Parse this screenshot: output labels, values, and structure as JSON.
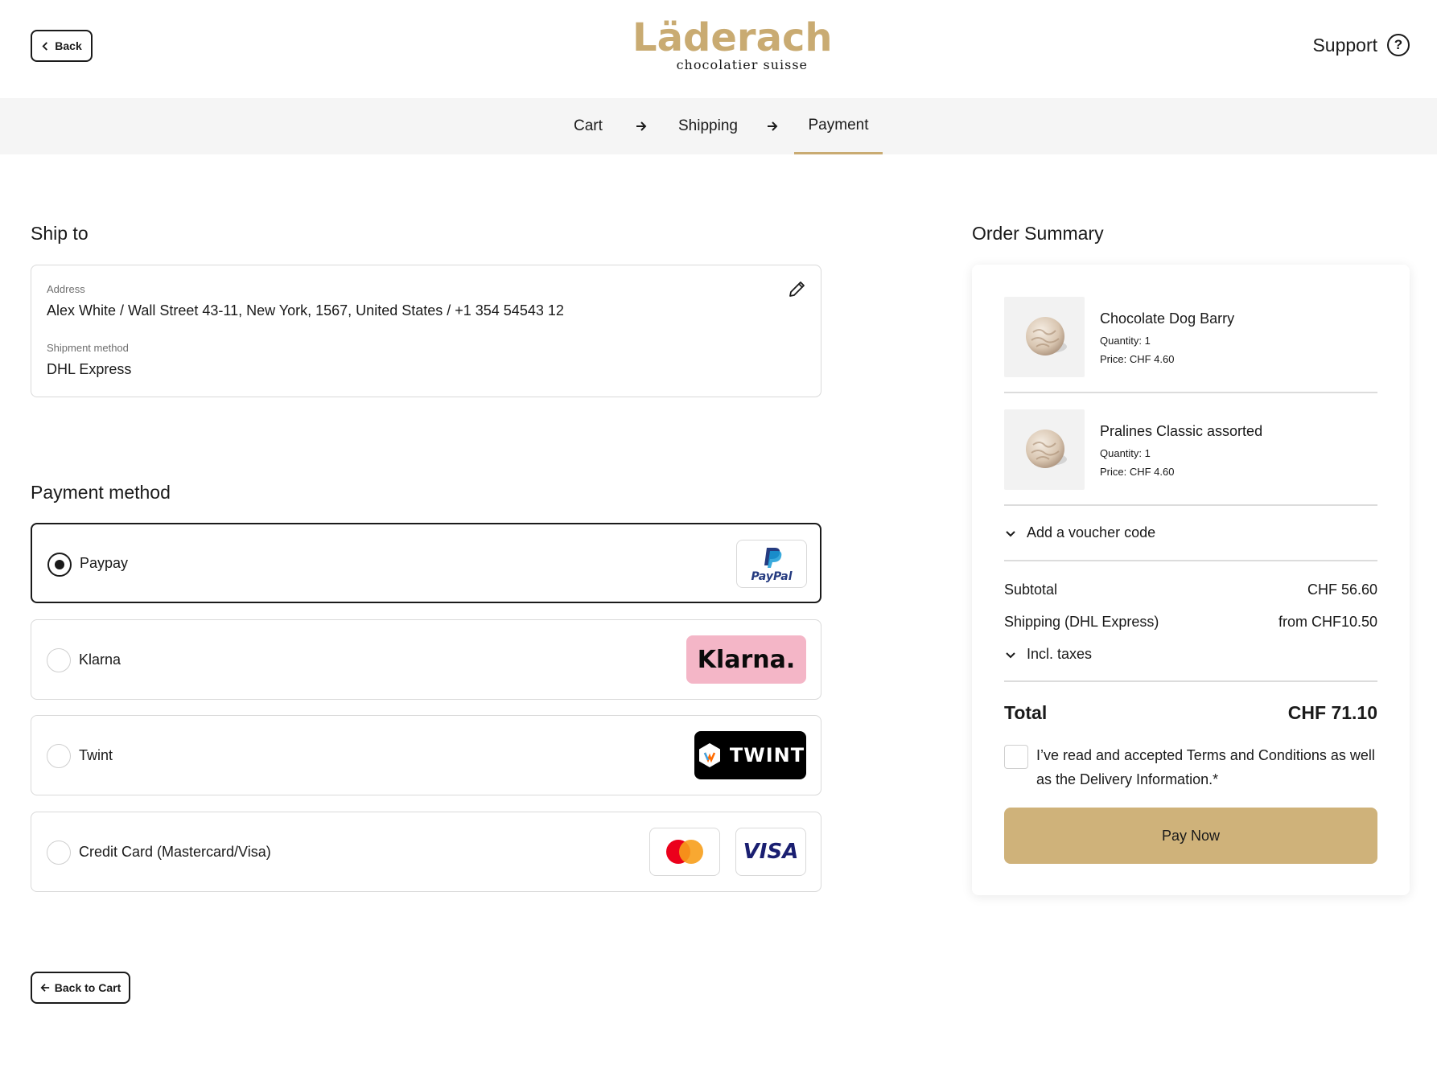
{
  "header": {
    "back_label": "Back",
    "brand_name": "Läderach",
    "brand_tagline": "chocolatier suisse",
    "support_label": "Support"
  },
  "steps": {
    "cart": "Cart",
    "shipping": "Shipping",
    "payment": "Payment",
    "active": "Payment"
  },
  "ship_to": {
    "title": "Ship to",
    "address_label": "Address",
    "address_value": "Alex White / Wall Street 43-11, New York, 1567, United States / +1 354 54543 12",
    "shipment_label": "Shipment method",
    "shipment_value": "DHL Express"
  },
  "payment": {
    "title": "Payment method",
    "options": [
      {
        "label": "Paypay",
        "selected": true,
        "logo": "paypal-logo",
        "logo_text": "PayPal"
      },
      {
        "label": "Klarna",
        "selected": false,
        "logo": "klarna-logo",
        "logo_text": "Klarna."
      },
      {
        "label": "Twint",
        "selected": false,
        "logo": "twint-logo",
        "logo_text": "TWINT"
      },
      {
        "label": "Credit Card (Mastercard/Visa)",
        "selected": false,
        "logo": "mastercard-visa-logos",
        "logo_text": "VISA"
      }
    ],
    "back_to_cart_label": "Back to Cart"
  },
  "summary": {
    "title": "Order Summary",
    "items": [
      {
        "name": "Chocolate Dog Barry",
        "quantity": "Quantity: 1",
        "price": "Price: CHF 4.60"
      },
      {
        "name": "Pralines Classic assorted",
        "quantity": "Quantity: 1",
        "price": "Price: CHF 4.60"
      }
    ],
    "voucher_label": "Add a voucher code",
    "subtotal_label": "Subtotal",
    "subtotal_value": "CHF 56.60",
    "shipping_label": "Shipping (DHL Express)",
    "shipping_value": "from CHF10.50",
    "taxes_label": "Incl. taxes",
    "total_label": "Total",
    "total_value": "CHF 71.10",
    "terms_text": "I’ve read and accepted Terms and Conditions as well as the Delivery Information.*",
    "pay_now_label": "Pay Now"
  },
  "colors": {
    "brand_gold": "#c9ab72",
    "pay_button": "#cfb27a",
    "klarna_pink": "#f4b6c7",
    "paypal_dark": "#253b80",
    "paypal_light": "#179bd7",
    "visa_blue": "#1a1f71"
  }
}
